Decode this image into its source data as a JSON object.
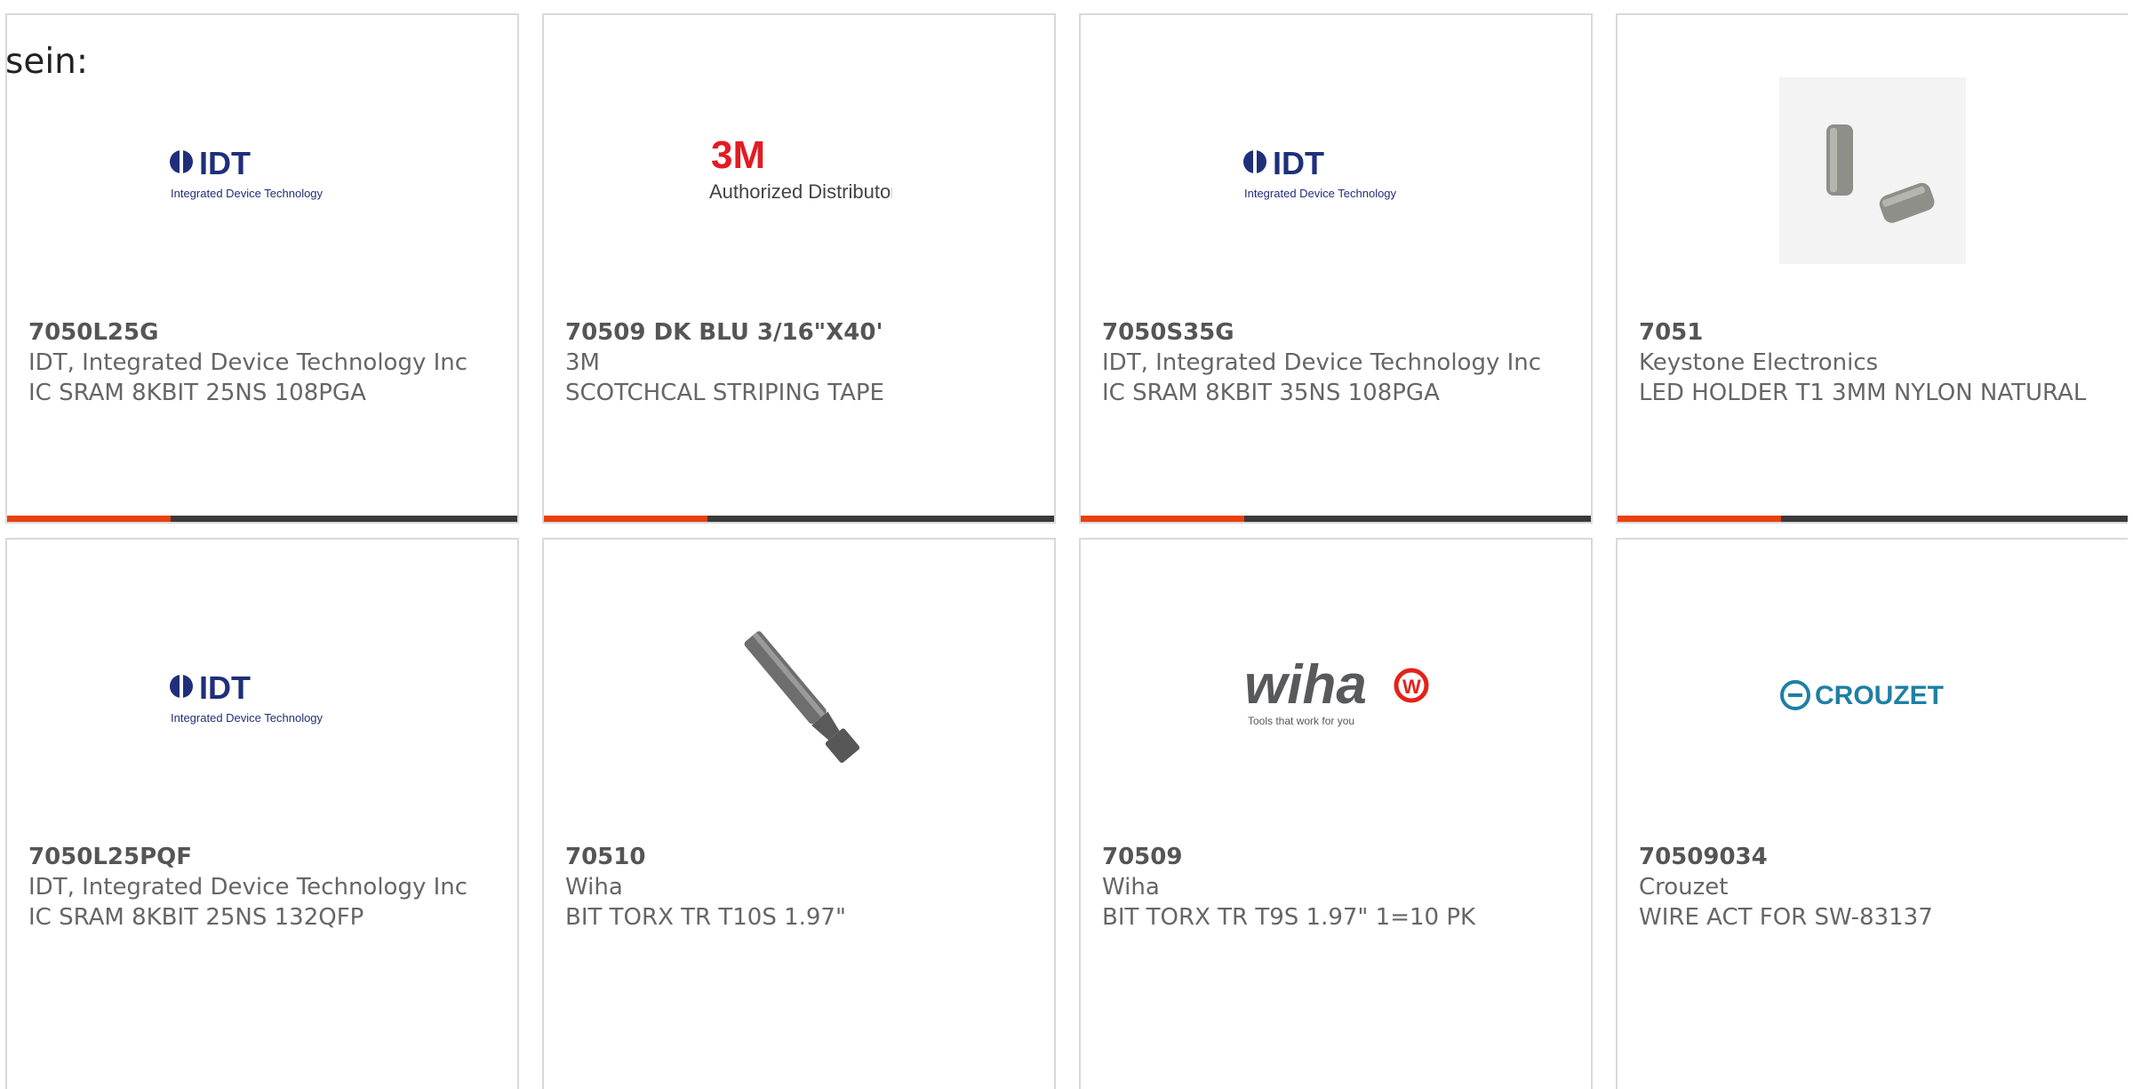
{
  "intro_text": "sein:",
  "colors": {
    "accent": "#e8410e",
    "bar": "#3a3a3a",
    "border": "#d9d9d9",
    "text": "#666666"
  },
  "products": [
    {
      "part": "7050L25G",
      "manufacturer": "IDT, Integrated Device Technology Inc",
      "description": "IC SRAM 8KBIT 25NS 108PGA",
      "logo": "idt-logo",
      "logo_text": "IDT",
      "logo_sub": "Integrated Device Technology"
    },
    {
      "part": "70509 DK BLU 3/16\"X40'",
      "manufacturer": "3M",
      "description": "SCOTCHCAL STRIPING TAPE",
      "logo": "3m-logo",
      "logo_text": "3M",
      "logo_sub": "Authorized Distributor"
    },
    {
      "part": "7050S35G",
      "manufacturer": "IDT, Integrated Device Technology Inc",
      "description": "IC SRAM 8KBIT 35NS 108PGA",
      "logo": "idt-logo",
      "logo_text": "IDT",
      "logo_sub": "Integrated Device Technology"
    },
    {
      "part": "7051",
      "manufacturer": "Keystone Electronics",
      "description": "LED HOLDER T1 3MM NYLON NATURAL",
      "logo": "led-holder-photo"
    },
    {
      "part": "7050L25PQF",
      "manufacturer": "IDT, Integrated Device Technology Inc",
      "description": "IC SRAM 8KBIT 25NS 132QFP",
      "logo": "idt-logo",
      "logo_text": "IDT",
      "logo_sub": "Integrated Device Technology"
    },
    {
      "part": "70510",
      "manufacturer": "Wiha",
      "description": "BIT TORX TR T10S 1.97\"",
      "logo": "torx-bit-photo"
    },
    {
      "part": "70509",
      "manufacturer": "Wiha",
      "description": "BIT TORX TR T9S 1.97\" 1=10 PK",
      "logo": "wiha-logo",
      "logo_text": "wiha",
      "logo_sub": "Tools that work for you"
    },
    {
      "part": "70509034",
      "manufacturer": "Crouzet",
      "description": "WIRE ACT FOR SW-83137",
      "logo": "crouzet-logo",
      "logo_text": "CROUZET"
    }
  ]
}
